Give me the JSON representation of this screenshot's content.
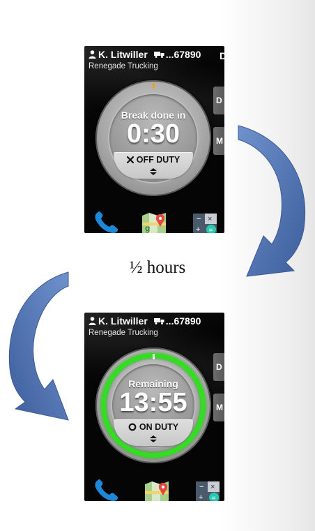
{
  "caption": "½ hours",
  "screens": [
    {
      "driver_name": "K. Litwiller",
      "vehicle_id": "...67890",
      "company": "Renegade Trucking",
      "clipped_header_letter": "D",
      "side_buttons": [
        "D",
        "M"
      ],
      "dial_label": "Break done in",
      "dial_time": "0:30",
      "status_label": "OFF DUTY",
      "status_icon": "x-icon",
      "ring_color": "#9a9a9a",
      "tick_color": "#f0a020",
      "dock": [
        "phone-icon",
        "maps-icon",
        "calculator-icon"
      ]
    },
    {
      "driver_name": "K. Litwiller",
      "vehicle_id": "...67890",
      "company": "Renegade Trucking",
      "side_buttons": [
        "D",
        "M"
      ],
      "dial_label": "Remaining",
      "dial_time": "13:55",
      "status_label": "ON DUTY",
      "status_icon": "circle-icon",
      "ring_color": "#33dd22",
      "tick_color": "#ffffff",
      "dock": [
        "phone-icon",
        "maps-icon",
        "calculator-icon"
      ]
    }
  ],
  "colors": {
    "arrow": "#4f73b3",
    "active_ring": "#33dd22"
  }
}
